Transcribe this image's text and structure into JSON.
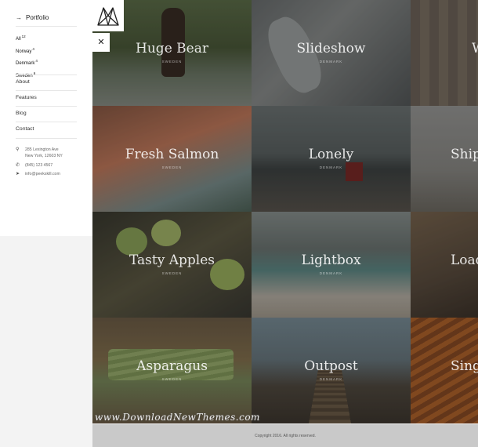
{
  "sidebar": {
    "portfolio_label": "Portfolio",
    "filters": [
      {
        "label": "All",
        "count": "12"
      },
      {
        "label": "Norway",
        "count": "4"
      },
      {
        "label": "Denmark",
        "count": "4"
      },
      {
        "label": "Sweden",
        "count": "6"
      }
    ],
    "nav": [
      {
        "label": "About"
      },
      {
        "label": "Features"
      },
      {
        "label": "Blog"
      },
      {
        "label": "Contact"
      }
    ],
    "contact": {
      "address_line1": "285 Lexington Ave",
      "address_line2": "New York, 12603 NY",
      "phone": "(845) 123 4567",
      "email": "info@peekskill.com"
    }
  },
  "tiles": [
    {
      "title": "Huge Bear",
      "subtitle": "SWEDEN"
    },
    {
      "title": "Slideshow",
      "subtitle": "DENMARK"
    },
    {
      "title": "W",
      "subtitle": ""
    },
    {
      "title": "Fresh Salmon",
      "subtitle": "SWEDEN"
    },
    {
      "title": "Lonely",
      "subtitle": "DENMARK"
    },
    {
      "title": "Ship",
      "subtitle": ""
    },
    {
      "title": "Tasty Apples",
      "subtitle": "SWEDEN"
    },
    {
      "title": "Lightbox",
      "subtitle": "DENMARK"
    },
    {
      "title": "Load",
      "subtitle": ""
    },
    {
      "title": "Asparagus",
      "subtitle": "SWEDEN"
    },
    {
      "title": "Outpost",
      "subtitle": "DENMARK"
    },
    {
      "title": "Singl",
      "subtitle": ""
    }
  ],
  "watermark": "www.DownloadNewThemes.com",
  "footer": {
    "copyright": "Copyright 2016. All rights reserved."
  },
  "icons": {
    "close": "close-icon",
    "logo": "mountain-logo-icon"
  }
}
